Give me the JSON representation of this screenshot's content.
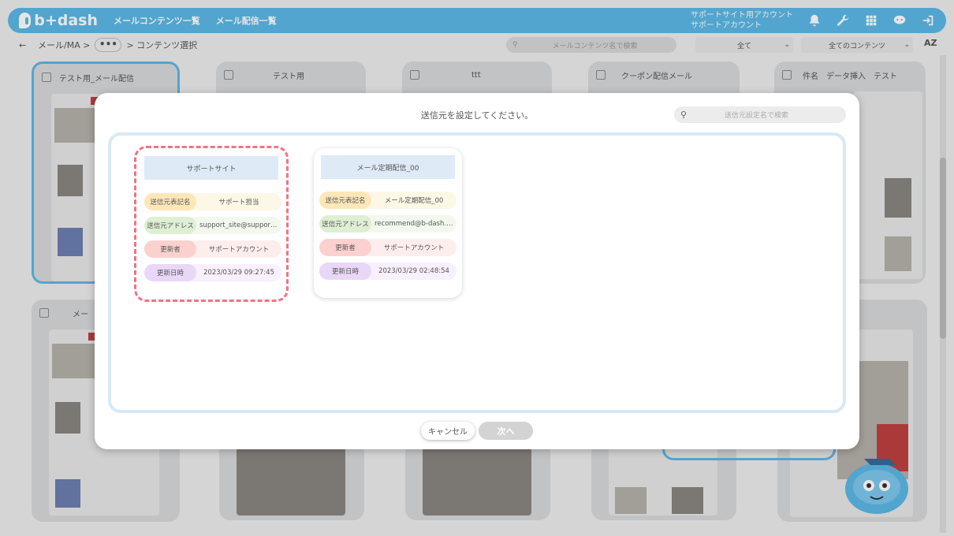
{
  "app": {
    "logo_text": "b+dash",
    "nav": [
      "メールコンテンツ一覧",
      "メール配信一覧"
    ],
    "account_line1": "サポートサイト用アカウント",
    "account_line2": "サポートアカウント",
    "accent_color": "#5cb8e6"
  },
  "subbar": {
    "back": "←",
    "crumb1": "メール/MA >",
    "dots": "•••",
    "crumb2": "> コンテンツ選択",
    "search_placeholder": "メールコンテンツ名で検索",
    "select1": "全て",
    "select2": "全てのコンテンツ",
    "sort_icon_label": "AZ"
  },
  "background_cards": [
    {
      "title": "テスト用_メール配信"
    },
    {
      "title": "テスト用"
    },
    {
      "title": "ttt"
    },
    {
      "title": "クーポン配信メール"
    },
    {
      "title": "件名　データ挿入　テスト"
    },
    {
      "title": "メー"
    }
  ],
  "modal": {
    "title": "送信元を設定してください。",
    "search_placeholder": "送信元設定名で検索",
    "cancel_label": "キャンセル",
    "next_label": "次へ",
    "senders": [
      {
        "name": "サポートサイト",
        "selected": true,
        "rows": [
          {
            "label": "送信元表記名",
            "value": "サポート担当"
          },
          {
            "label": "送信元アドレス",
            "value": "support_site@support.b-dash.com"
          },
          {
            "label": "更新者",
            "value": "サポートアカウント"
          },
          {
            "label": "更新日時",
            "value": "2023/03/29 09:27:45"
          }
        ]
      },
      {
        "name": "メール定期配信_00",
        "selected": false,
        "rows": [
          {
            "label": "送信元表記名",
            "value": "メール定期配信_00"
          },
          {
            "label": "送信元アドレス",
            "value": "recommend@b-dash.com"
          },
          {
            "label": "更新者",
            "value": "サポートアカウント"
          },
          {
            "label": "更新日時",
            "value": "2023/03/29 02:48:54"
          }
        ]
      }
    ]
  }
}
